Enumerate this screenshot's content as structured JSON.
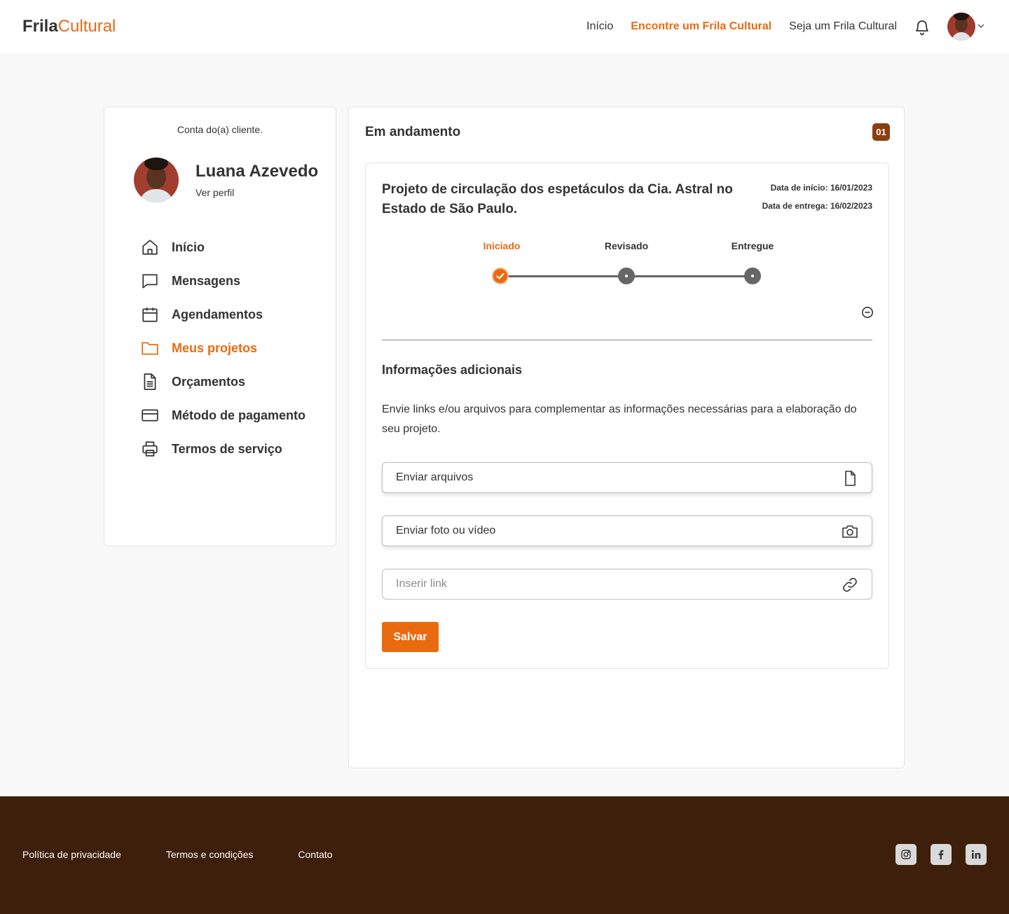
{
  "brand": {
    "part1": "Frila",
    "part2": "Cultural"
  },
  "nav": {
    "items": [
      {
        "label": "Início",
        "active": false
      },
      {
        "label": "Encontre um Frila Cultural",
        "active": true
      },
      {
        "label": "Seja um Frila Cultural",
        "active": false
      }
    ]
  },
  "sidebar": {
    "caption": "Conta do(a) cliente.",
    "user_name": "Luana Azevedo",
    "profile_link": "Ver perfil",
    "items": [
      {
        "label": "Início",
        "icon": "home-icon"
      },
      {
        "label": "Mensagens",
        "icon": "message-icon"
      },
      {
        "label": "Agendamentos",
        "icon": "calendar-icon"
      },
      {
        "label": "Meus projetos",
        "icon": "folder-icon",
        "active": true
      },
      {
        "label": "Orçamentos",
        "icon": "document-icon"
      },
      {
        "label": "Método de pagamento",
        "icon": "credit-card-icon"
      },
      {
        "label": "Termos de serviço",
        "icon": "printer-icon"
      }
    ]
  },
  "main": {
    "title": "Em andamento",
    "count": "01",
    "project": {
      "title": "Projeto de circulação dos espetáculos da Cia. Astral no Estado de São Paulo.",
      "start_date": "Data de início: 16/01/2023",
      "delivery_date": "Data de entrega: 16/02/2023",
      "steps": [
        {
          "label": "Iniciado",
          "done": true
        },
        {
          "label": "Revisado",
          "done": false
        },
        {
          "label": "Entregue",
          "done": false
        }
      ]
    },
    "additional": {
      "title": "Informações adicionais",
      "text": "Envie links e/ou arquivos para complementar as informações necessárias para a elaboração do seu projeto.",
      "upload_files": "Enviar arquivos",
      "upload_media": "Enviar foto ou vídeo",
      "link_placeholder": "Inserir link",
      "link_value": ""
    },
    "save_label": "Salvar"
  },
  "footer": {
    "links": [
      "Política de privacidade",
      "Termos e condições",
      "Contato"
    ],
    "socials": [
      "instagram-icon",
      "facebook-icon",
      "linkedin-icon"
    ]
  },
  "colors": {
    "accent": "#ea6a10",
    "footer_bg": "#3d1f0b",
    "badge": "#8a3d12"
  }
}
